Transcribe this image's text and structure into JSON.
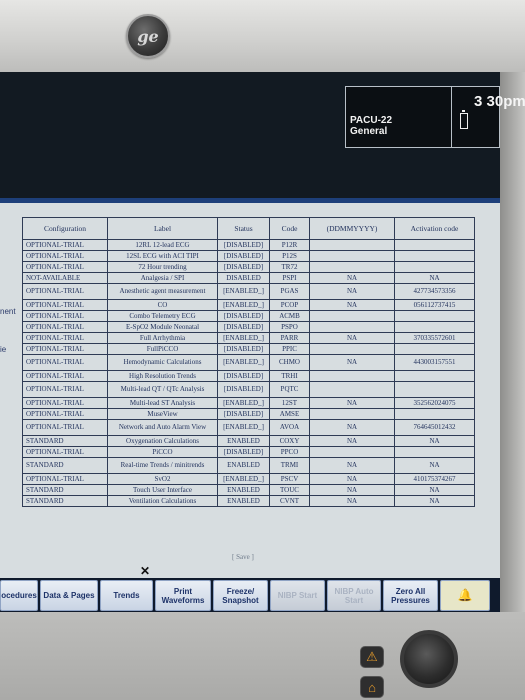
{
  "header": {
    "room": "PACU-22",
    "profile": "General",
    "time": "3 30pm"
  },
  "side_labels": [
    "nent",
    "ie"
  ],
  "table": {
    "headers": [
      "Configuration",
      "Label",
      "Status",
      "Code",
      "(DDMMYYYY)",
      "Activation code"
    ],
    "rows": [
      [
        "OPTIONAL-TRIAL",
        "12RL 12-lead ECG",
        "[DISABLED]",
        "P12R",
        "",
        ""
      ],
      [
        "OPTIONAL-TRIAL",
        "12SL ECG with ACI TIPI",
        "[DISABLED]",
        "P12S",
        "",
        ""
      ],
      [
        "OPTIONAL-TRIAL",
        "72 Hour trending",
        "[DISABLED]",
        "TR72",
        "",
        ""
      ],
      [
        "NOT-AVAILABLE",
        "Analgesia / SPI",
        "DISABLED",
        "PSPI",
        "NA",
        "NA"
      ],
      [
        "OPTIONAL-TRIAL",
        "Anesthetic agent measurement",
        "[ENABLED_]",
        "PGAS",
        "NA",
        "427734573356"
      ],
      [
        "OPTIONAL-TRIAL",
        "CO",
        "[ENABLED_]",
        "PCOP",
        "NA",
        "056112737415"
      ],
      [
        "OPTIONAL-TRIAL",
        "Combo Telemetry ECG",
        "[DISABLED]",
        "ACMB",
        "",
        ""
      ],
      [
        "OPTIONAL-TRIAL",
        "E-SpO2 Module Neonatal",
        "[DISABLED]",
        "PSPO",
        "",
        ""
      ],
      [
        "OPTIONAL-TRIAL",
        "Full Arrhythmia",
        "[ENABLED_]",
        "PARR",
        "NA",
        "370335572601"
      ],
      [
        "OPTIONAL-TRIAL",
        "FullPiCCO",
        "[DISABLED]",
        "PPIC",
        "",
        ""
      ],
      [
        "OPTIONAL-TRIAL",
        "Hemodynamic Calculations",
        "[ENABLED_]",
        "CHMO",
        "NA",
        "443003157551"
      ],
      [
        "OPTIONAL-TRIAL",
        "High Resolution Trends",
        "[DISABLED]",
        "TRHI",
        "",
        ""
      ],
      [
        "OPTIONAL-TRIAL",
        "Multi-lead QT / QTc Analysis",
        "[DISABLED]",
        "PQTC",
        "",
        ""
      ],
      [
        "OPTIONAL-TRIAL",
        "Multi-lead ST Analysis",
        "[ENABLED_]",
        "12ST",
        "NA",
        "352562024075"
      ],
      [
        "OPTIONAL-TRIAL",
        "MuseView",
        "[DISABLED]",
        "AMSE",
        "",
        ""
      ],
      [
        "OPTIONAL-TRIAL",
        "Network and Auto Alarm View",
        "[ENABLED_]",
        "AVOA",
        "NA",
        "764645012432"
      ],
      [
        "STANDARD",
        "Oxygenation Calculations",
        "ENABLED",
        "COXY",
        "NA",
        "NA"
      ],
      [
        "OPTIONAL-TRIAL",
        "PiCCO",
        "[DISABLED]",
        "PPCO",
        "",
        ""
      ],
      [
        "STANDARD",
        "Real-time Trends / minitrends",
        "ENABLED",
        "TRMI",
        "NA",
        "NA"
      ],
      [
        "OPTIONAL-TRIAL",
        "SvO2",
        "[ENABLED_]",
        "PSCV",
        "NA",
        "410175374267"
      ],
      [
        "STANDARD",
        "Touch User Interface",
        "ENABLED",
        "TOUC",
        "NA",
        "NA"
      ],
      [
        "STANDARD",
        "Ventilation Calculations",
        "ENABLED",
        "CVNT",
        "NA",
        "NA"
      ]
    ]
  },
  "save_label": "[ Save ]",
  "softkeys": [
    {
      "label": "ocedures",
      "enabled": true
    },
    {
      "label": "Data & Pages",
      "enabled": true
    },
    {
      "label": "Trends",
      "enabled": true
    },
    {
      "label": "Print Waveforms",
      "enabled": true
    },
    {
      "label": "Freeze/ Snapshot",
      "enabled": true
    },
    {
      "label": "NIBP Start",
      "enabled": false
    },
    {
      "label": "NIBP Auto Start",
      "enabled": false
    },
    {
      "label": "Zero All Pressures",
      "enabled": true
    },
    {
      "label": "",
      "enabled": true,
      "icon": "alarm-bell-icon"
    }
  ],
  "colors": {
    "screen_header": "#121a22",
    "content_bg": "#d7dde0",
    "table_text": "#1f2f5a",
    "softkey_text": "#1d3268"
  }
}
